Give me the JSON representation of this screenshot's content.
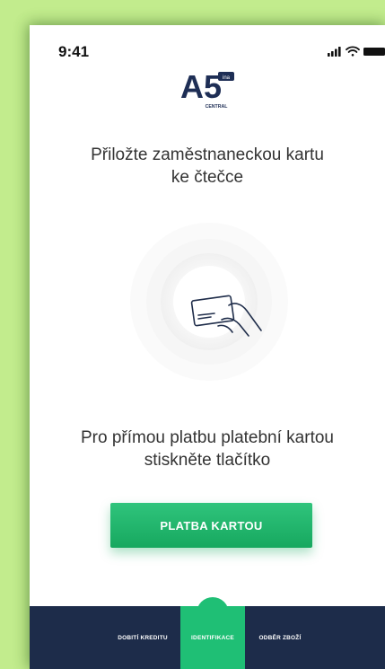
{
  "status_bar": {
    "time": "9:41"
  },
  "logo": {
    "main": "A5",
    "sub": "CENTRAL",
    "tag": "ina"
  },
  "main": {
    "title_line1": "Přiložte zaměstnaneckou kartu",
    "title_line2": "ke čtečce",
    "hint_line1": "Pro přímou platbu platební kartou",
    "hint_line2": "stiskněte tlačítko",
    "pay_button_label": "PLATBA KARTOU"
  },
  "tabbar": {
    "tabs": [
      {
        "label": "DOBITÍ KREDITU",
        "active": false
      },
      {
        "label": "IDENTIFIKACE",
        "active": true
      },
      {
        "label": "ODBĚR ZBOŽÍ",
        "active": false
      }
    ]
  },
  "colors": {
    "accent_green": "#1fbf75",
    "tabbar_navy": "#1d2c4a",
    "logo_navy": "#1e2e55",
    "background_green": "#c2ec8d"
  }
}
